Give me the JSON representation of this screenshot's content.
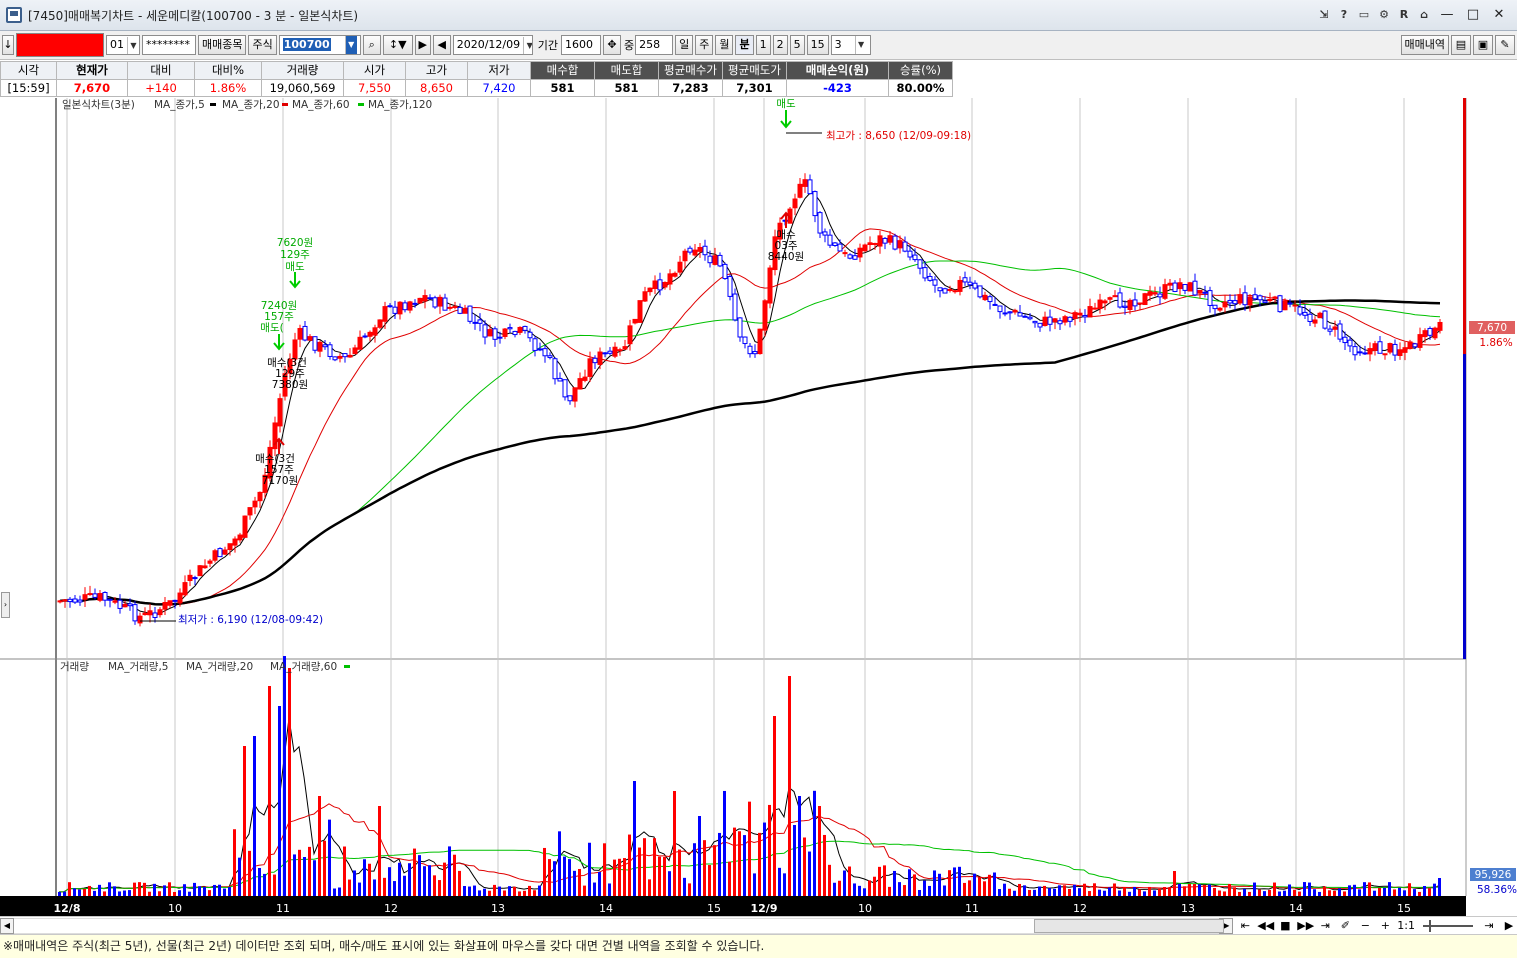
{
  "window": {
    "title": "[7450]매매복기차트 - 세운메디칼(100700 - 3 분 - 일본식차트)"
  },
  "toolbar": {
    "down_arrow": "↓",
    "account_no": "01",
    "password": "********",
    "trade_items_button": "매매종목",
    "market_type": "주식",
    "stock_code": "100700",
    "date": "2020/12/09",
    "period_label": "기간",
    "period_value": "1600",
    "middle_label": "중",
    "middle_value": "258",
    "day_btn": "일",
    "week_btn": "주",
    "month_btn": "월",
    "minute_btn": "분",
    "interval_1": "1",
    "interval_2": "2",
    "interval_5": "5",
    "interval_15": "15",
    "interval_select": "3",
    "trade_history_button": "매매내역"
  },
  "info": {
    "headers": [
      "시각",
      "현재가",
      "대비",
      "대비%",
      "거래량",
      "시가",
      "고가",
      "저가",
      "매수합",
      "매도합",
      "평균매수가",
      "평균매도가",
      "매매손익(원)",
      "승률(%)"
    ],
    "values": [
      "[15:59]",
      "7,670",
      "+140",
      "1.86%",
      "19,060,569",
      "7,550",
      "8,650",
      "7,420",
      "581",
      "581",
      "7,283",
      "7,301",
      "-423",
      "80.00%"
    ]
  },
  "chart": {
    "price_legend_title": "일본식차트(3분)",
    "price_legend": [
      "MA_종가,5",
      "MA_종가,20",
      "MA_종가,60",
      "MA_종가,120"
    ],
    "volume_legend_title": "거래량",
    "volume_legend": [
      "MA_거래량,5",
      "MA_거래량,20",
      "MA_거래량,60"
    ],
    "high_label": "최고가 : 8,650 (12/09-09:18)",
    "low_label": "최저가 : 6,190 (12/08-09:42)",
    "current_price_tag": "7,670",
    "current_change_tag": "1.86%",
    "volume_tag": "95,926",
    "volume_pct_tag": "58.36%",
    "x_labels": [
      "12/8",
      "10",
      "11",
      "12",
      "13",
      "14",
      "15",
      "12/9",
      "10",
      "11",
      "12",
      "13",
      "14",
      "15"
    ],
    "annotations": {
      "sell1_price": "7620원",
      "sell1_qty": "129주",
      "sell1_label": "매도",
      "sell2_price": "7240원",
      "sell2_qty": "157주",
      "sell2_label": "매도(",
      "buy1_label": "매수(3건",
      "buy1_qty": "129주",
      "buy1_price": "7380원",
      "buy2_label": "매수(3건",
      "buy2_qty": "157주",
      "buy2_price": "7170원",
      "sell3_label": "매도",
      "buy3_label": "매수",
      "buy3_qty": "03주",
      "buy3_price": "8440원"
    },
    "colors": {
      "up": "#ff0000",
      "down": "#0000ff",
      "ma5": "#000000",
      "ma20": "#e00000",
      "ma60": "#00c000",
      "ma120": "#000000",
      "marker": "#00cc00"
    }
  },
  "scroll": {
    "zoom": "1:1"
  },
  "status": {
    "message": "※매매내역은 주식(최근 5년), 선물(최근 2년) 데이터만 조회 되며, 매수/매도 표시에 있는 화살표에 마우스를 갖다 대면 건별 내역을 조회할 수 있습니다."
  }
}
